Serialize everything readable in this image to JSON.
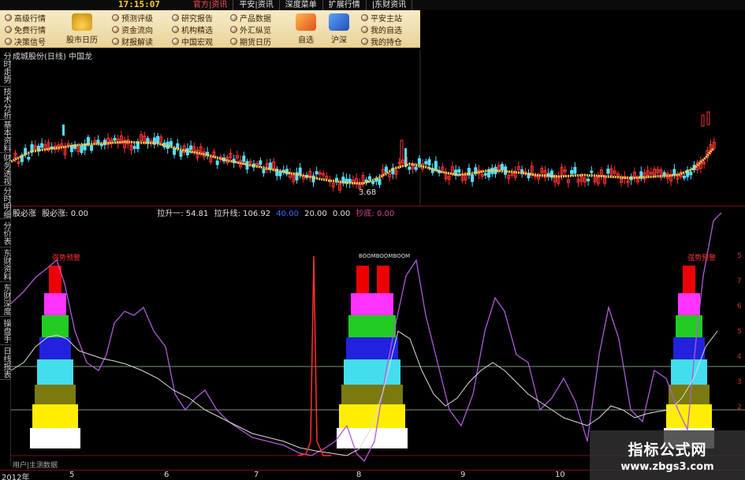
{
  "topbar": {
    "clock": "17:15:07",
    "menu": [
      "官方|资讯",
      "平安|资讯",
      "深度菜单",
      "扩展行情",
      "|东财资讯"
    ]
  },
  "quicklinks": {
    "col1": [
      "高级行情",
      "免费行情",
      "决策信号"
    ],
    "col2": [
      "预测评级",
      "资金流向",
      "财报解读"
    ],
    "col3": [
      "研究报告",
      "机构精选",
      "中国宏观"
    ],
    "col4": [
      "产品数据",
      "外汇纵览",
      "期货日历"
    ],
    "col5": [
      "平安主站",
      "我的自选",
      "我的持仓"
    ],
    "big_buttons": [
      "股市日历",
      "自选",
      "沪深"
    ]
  },
  "left_tabs": [
    "分时走势",
    "技术分析",
    "基本资料",
    "财务透视",
    "分时明细",
    "分价表",
    "东财资料",
    "东财深度",
    "操盘手",
    "日线报表"
  ],
  "main": {
    "title": "成城股份(日线) 中国龙",
    "low_label": "3.68"
  },
  "indicator": {
    "name": "股必涨",
    "name_value_label": "股必涨: 0.00",
    "lift1": "拉升一: 54.81",
    "lift_line": "拉升线: 106.92",
    "v40": "40.00",
    "v20": "20.00",
    "v0": "0.00",
    "bottom_label": "抄底: 0.00",
    "alert_left": "强势预警",
    "alert_mid": "BOOMBOOMBOOM",
    "alert_right": "强势预警"
  },
  "x_axis": {
    "labels": [
      "2012年",
      "5",
      "6",
      "7",
      "8",
      "9",
      "10"
    ]
  },
  "bottom": {
    "tab_label": "用户|主测数据"
  },
  "right_scale": [
    "5",
    "7",
    "6",
    "5",
    "4",
    "3",
    "2",
    "1"
  ],
  "watermark": {
    "title": "指标公式网",
    "url": "www.zbgs3.com"
  },
  "colors": {
    "candle_up": "#ff3333",
    "candle_down": "#55e0ff",
    "ma_line": "#ffcc55",
    "purple": "#b05ad8",
    "white_line": "#dddddd",
    "spike": "#ff3030"
  }
}
